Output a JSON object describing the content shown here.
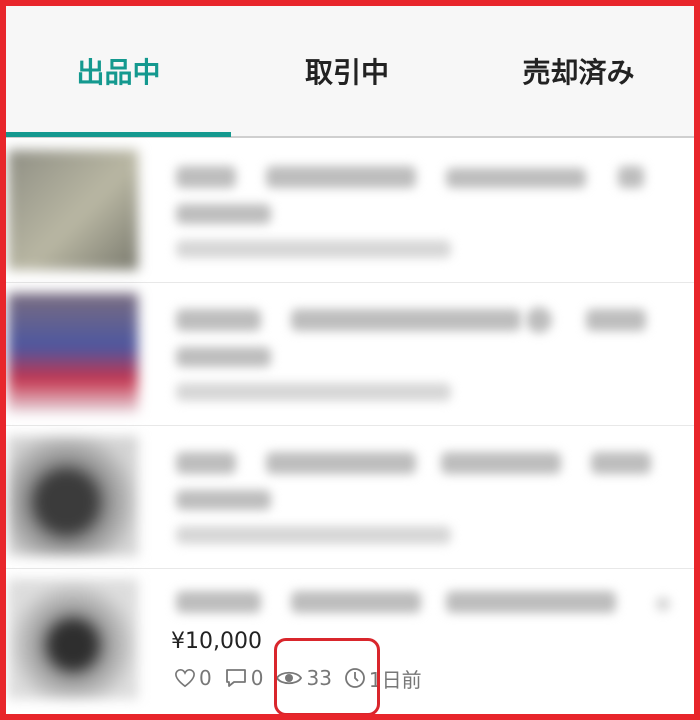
{
  "tabs": [
    {
      "label": "出品中",
      "active": true
    },
    {
      "label": "取引中",
      "active": false
    },
    {
      "label": "売却済み",
      "active": false
    }
  ],
  "listing": {
    "price": "¥10,000",
    "likes": "0",
    "comments": "0",
    "views": "33",
    "posted": "1日前"
  },
  "colors": {
    "accent": "#14998f",
    "highlight_border": "#d9262c",
    "frame_border": "#e8262b"
  },
  "icons": [
    "heart-icon",
    "comment-icon",
    "eye-icon",
    "clock-icon"
  ]
}
